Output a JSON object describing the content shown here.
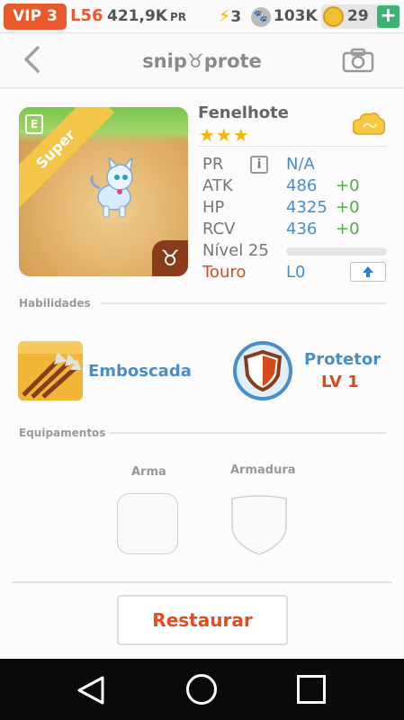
{
  "status": {
    "vip": "VIP 3",
    "level": "L56",
    "pr_value": "421,9K",
    "pr_label": "PR",
    "energy": "3",
    "paws": "103K",
    "coins": "29",
    "add_label": "+"
  },
  "header": {
    "back_icon": "chevron-left-icon",
    "title": "snip♉prote",
    "camera_icon": "camera-icon"
  },
  "pet": {
    "rarity_badge": "Super",
    "name": "Fenelhote",
    "stars": "★★★",
    "zodiac_symbol": "♉",
    "stats": {
      "pr_label": "PR",
      "pr_value": "N/A",
      "atk_label": "ATK",
      "atk_value": "486",
      "atk_bonus": "+0",
      "hp_label": "HP",
      "hp_value": "4325",
      "hp_bonus": "+0",
      "rcv_label": "RCV",
      "rcv_value": "436",
      "rcv_bonus": "+0",
      "level_label": "Nível 25",
      "sign_label": "Touro",
      "sign_level": "L0"
    }
  },
  "abilities": {
    "section_label": "Habilidades",
    "skill_name": "Emboscada",
    "passive_name": "Protetor",
    "passive_level": "LV 1"
  },
  "equipment": {
    "section_label": "Equipamentos",
    "weapon_label": "Arma",
    "armor_label": "Armadura"
  },
  "actions": {
    "restore_label": "Restaurar"
  },
  "colors": {
    "accent_orange": "#e85a2b",
    "stat_blue": "#4a8ec8",
    "bonus_green": "#5aa84e",
    "star_gold": "#f2b900"
  }
}
